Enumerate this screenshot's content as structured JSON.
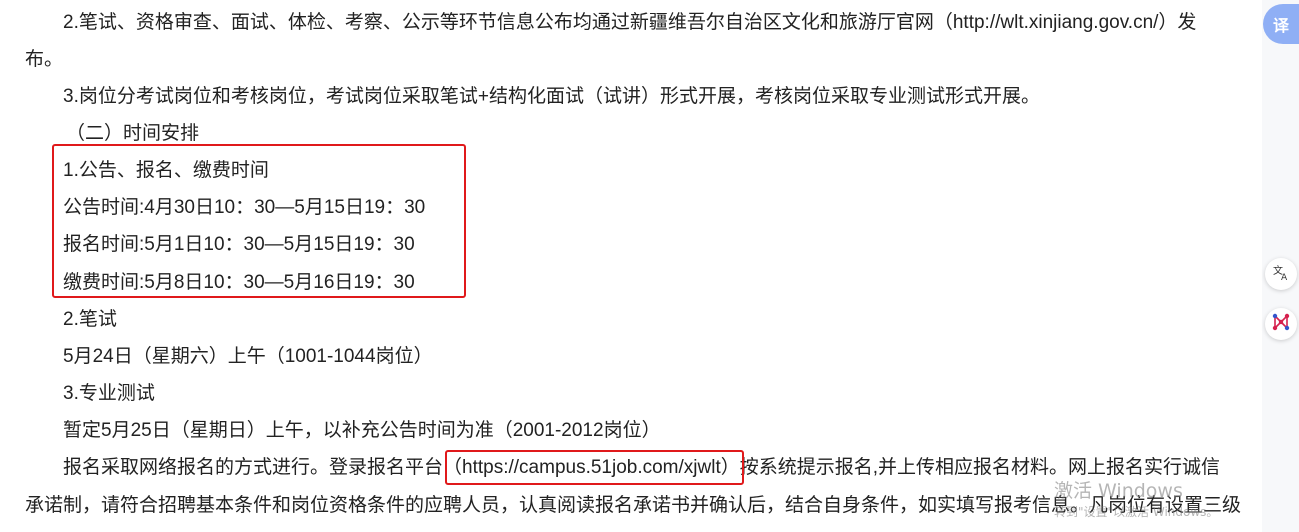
{
  "document": {
    "p1_line1": "2.笔试、资格审查、面试、体检、考察、公示等环节信息公布均通过新疆维吾尔自治区文化和旅游厅官网（http://wlt.xinjiang.gov.cn/）发",
    "p1_line2": "布。",
    "p2": "3.岗位分考试岗位和考核岗位，考试岗位采取笔试+结构化面试（试讲）形式开展，考核岗位采取专业测试形式开展。",
    "section_title": "（二）时间安排",
    "schedule_heading": "1.公告、报名、缴费时间",
    "announce_time": "公告时间:4月30日10：30—5月15日19：30",
    "signup_time": "报名时间:5月1日10：30—5月15日19：30",
    "payment_time": "缴费时间:5月8日10：30—5月16日19：30",
    "written_heading": "2.笔试",
    "written_time": "5月24日（星期六）上午（1001-1044岗位）",
    "pro_heading": "3.专业测试",
    "pro_time": "暂定5月25日（星期日）上午，以补充公告时间为准（2001-2012岗位）",
    "signup_method_prefix": "报名采取网络报名的方式进行。登录报名平台",
    "signup_link": "（https://campus.51job.com/xjwlt）",
    "signup_method_suffix": "按系统提示报名,并上传相应报名材料。网上报名实行诚信",
    "last_line": "承诺制，请符合招聘基本条件和岗位资格条件的应聘人员，认真阅读报名承诺书并确认后，结合自身条件，如实填写报考信息。凡岗位有设置三级"
  },
  "sidebar": {
    "translate_label": "译",
    "icons": [
      "translate-icon",
      "network-icon"
    ]
  },
  "watermark": {
    "line1": "激活 Windows",
    "line2": "转到\"设置\"以激活 Windows。"
  },
  "colors": {
    "highlight_box": "#e0191b",
    "translate_tab": "#8faff5",
    "network_icon": "#d6204e"
  }
}
